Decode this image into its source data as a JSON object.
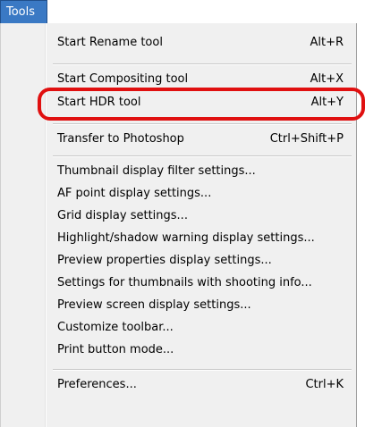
{
  "menubar": {
    "title": "Tools"
  },
  "menu": {
    "groups": [
      [
        {
          "label": "Start Rename tool",
          "shortcut": "Alt+R"
        }
      ],
      [
        {
          "label": "Start Compositing tool",
          "shortcut": "Alt+X"
        },
        {
          "label": "Start HDR tool",
          "shortcut": "Alt+Y"
        }
      ],
      [
        {
          "label": "Transfer to Photoshop",
          "shortcut": "Ctrl+Shift+P"
        }
      ],
      [
        {
          "label": "Thumbnail display filter settings...",
          "shortcut": ""
        },
        {
          "label": "AF point display settings...",
          "shortcut": ""
        },
        {
          "label": "Grid display settings...",
          "shortcut": ""
        },
        {
          "label": "Highlight/shadow warning display settings...",
          "shortcut": ""
        },
        {
          "label": "Preview properties display settings...",
          "shortcut": ""
        },
        {
          "label": "Settings for thumbnails with shooting info...",
          "shortcut": ""
        },
        {
          "label": "Preview screen display settings...",
          "shortcut": ""
        },
        {
          "label": "Customize toolbar...",
          "shortcut": ""
        },
        {
          "label": "Print button mode...",
          "shortcut": ""
        }
      ],
      [
        {
          "label": "Preferences...",
          "shortcut": "Ctrl+K"
        }
      ]
    ]
  },
  "annotation": {
    "highlighted_item": "Start HDR tool",
    "color": "#e01010"
  }
}
